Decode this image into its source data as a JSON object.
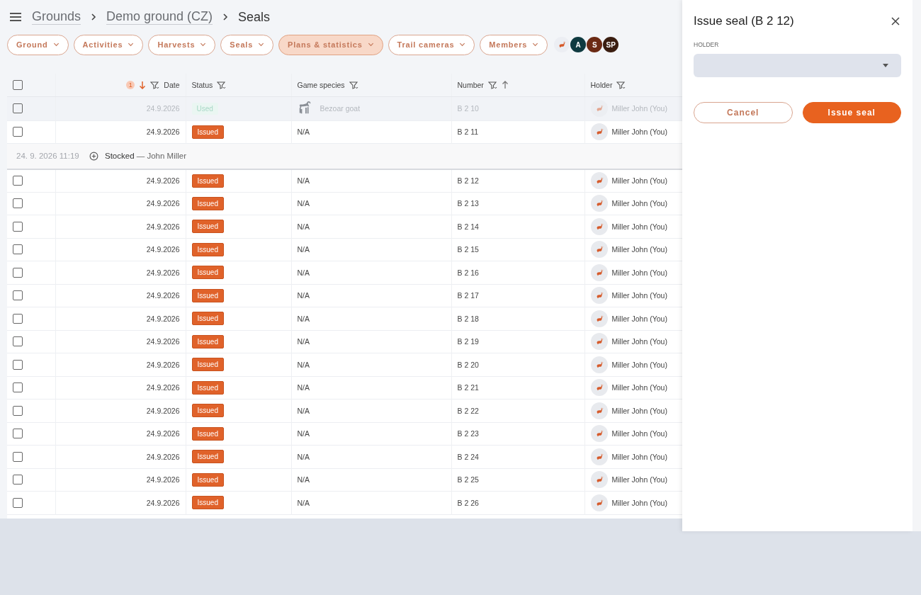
{
  "breadcrumb": [
    {
      "label": "Grounds",
      "kind": "link"
    },
    {
      "label": "Demo ground (CZ)",
      "kind": "link"
    },
    {
      "label": "Seals",
      "kind": "current"
    }
  ],
  "nav": [
    {
      "label": "Ground",
      "selected": false
    },
    {
      "label": "Activities",
      "selected": false
    },
    {
      "label": "Harvests",
      "selected": false
    },
    {
      "label": "Seals",
      "selected": false
    },
    {
      "label": "Plans & statistics",
      "selected": true
    },
    {
      "label": "Trail cameras",
      "selected": false
    },
    {
      "label": "Members",
      "selected": false
    }
  ],
  "avatars": [
    {
      "kind": "icon",
      "color": "#eceef3"
    },
    {
      "kind": "initials",
      "initials": "A",
      "color": "#0f3a40"
    },
    {
      "kind": "initials",
      "initials": "S",
      "color": "#6b2a14"
    },
    {
      "kind": "initials",
      "initials": "SP",
      "color": "#3a1d10"
    }
  ],
  "table": {
    "header_checked": false,
    "columns": [
      {
        "label": "Date",
        "filter": true,
        "sorted": true,
        "descending": true,
        "sort_rank": "1"
      },
      {
        "label": "Status",
        "filter": true,
        "sorted": false
      },
      {
        "label": "Game species",
        "filter": true,
        "sorted": false
      },
      {
        "label": "Number",
        "filter": true,
        "sorted": true,
        "descending": false
      },
      {
        "label": "Holder",
        "filter": true,
        "sorted": false
      }
    ],
    "rows": [
      {
        "kind": "seal",
        "checked": false,
        "used": true,
        "date": "24.9.2026",
        "status": "Used",
        "species": "Bezoar goat",
        "species_icon": true,
        "number": "B 2 10",
        "holder": "Miller John (You)"
      },
      {
        "kind": "seal",
        "checked": false,
        "used": false,
        "date": "24.9.2026",
        "status": "Issued",
        "species": "N/A",
        "species_icon": false,
        "number": "B 2 11",
        "holder": "Miller John (You)"
      },
      {
        "kind": "group",
        "time": "24. 9. 2026 11:19",
        "text": "**Stocked** — John Miller"
      },
      {
        "kind": "seal",
        "checked": false,
        "used": false,
        "date": "24.9.2026",
        "status": "Issued",
        "species": "N/A",
        "species_icon": false,
        "number": "B 2 12",
        "holder": "Miller John (You)"
      },
      {
        "kind": "seal",
        "checked": false,
        "used": false,
        "date": "24.9.2026",
        "status": "Issued",
        "species": "N/A",
        "species_icon": false,
        "number": "B 2 13",
        "holder": "Miller John (You)"
      },
      {
        "kind": "seal",
        "checked": false,
        "used": false,
        "date": "24.9.2026",
        "status": "Issued",
        "species": "N/A",
        "species_icon": false,
        "number": "B 2 14",
        "holder": "Miller John (You)"
      },
      {
        "kind": "seal",
        "checked": false,
        "used": false,
        "date": "24.9.2026",
        "status": "Issued",
        "species": "N/A",
        "species_icon": false,
        "number": "B 2 15",
        "holder": "Miller John (You)"
      },
      {
        "kind": "seal",
        "checked": false,
        "used": false,
        "date": "24.9.2026",
        "status": "Issued",
        "species": "N/A",
        "species_icon": false,
        "number": "B 2 16",
        "holder": "Miller John (You)"
      },
      {
        "kind": "seal",
        "checked": false,
        "used": false,
        "date": "24.9.2026",
        "status": "Issued",
        "species": "N/A",
        "species_icon": false,
        "number": "B 2 17",
        "holder": "Miller John (You)"
      },
      {
        "kind": "seal",
        "checked": false,
        "used": false,
        "date": "24.9.2026",
        "status": "Issued",
        "species": "N/A",
        "species_icon": false,
        "number": "B 2 18",
        "holder": "Miller John (You)"
      },
      {
        "kind": "seal",
        "checked": false,
        "used": false,
        "date": "24.9.2026",
        "status": "Issued",
        "species": "N/A",
        "species_icon": false,
        "number": "B 2 19",
        "holder": "Miller John (You)"
      },
      {
        "kind": "seal",
        "checked": false,
        "used": false,
        "date": "24.9.2026",
        "status": "Issued",
        "species": "N/A",
        "species_icon": false,
        "number": "B 2 20",
        "holder": "Miller John (You)"
      },
      {
        "kind": "seal",
        "checked": false,
        "used": false,
        "date": "24.9.2026",
        "status": "Issued",
        "species": "N/A",
        "species_icon": false,
        "number": "B 2 21",
        "holder": "Miller John (You)"
      },
      {
        "kind": "seal",
        "checked": false,
        "used": false,
        "date": "24.9.2026",
        "status": "Issued",
        "species": "N/A",
        "species_icon": false,
        "number": "B 2 22",
        "holder": "Miller John (You)"
      },
      {
        "kind": "seal",
        "checked": false,
        "used": false,
        "date": "24.9.2026",
        "status": "Issued",
        "species": "N/A",
        "species_icon": false,
        "number": "B 2 23",
        "holder": "Miller John (You)"
      },
      {
        "kind": "seal",
        "checked": false,
        "used": false,
        "date": "24.9.2026",
        "status": "Issued",
        "species": "N/A",
        "species_icon": false,
        "number": "B 2 24",
        "holder": "Miller John (You)"
      },
      {
        "kind": "seal",
        "checked": false,
        "used": false,
        "date": "24.9.2026",
        "status": "Issued",
        "species": "N/A",
        "species_icon": false,
        "number": "B 2 25",
        "holder": "Miller John (You)"
      },
      {
        "kind": "seal",
        "checked": false,
        "used": false,
        "date": "24.9.2026",
        "status": "Issued",
        "species": "N/A",
        "species_icon": false,
        "number": "B 2 26",
        "holder": "Miller John (You)"
      }
    ]
  },
  "panel": {
    "title": "Issue seal (B 2 12)",
    "field_label": "HOLDER",
    "buttons": [
      {
        "label": "Cancel",
        "kind": "secondary"
      },
      {
        "label": "Issue seal",
        "kind": "primary"
      }
    ]
  }
}
